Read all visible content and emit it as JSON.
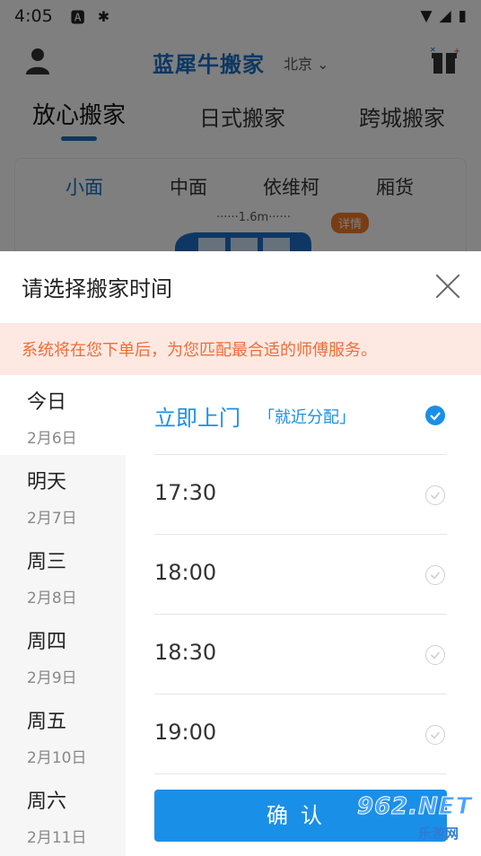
{
  "status_bar": {
    "time": "4:05",
    "icons": [
      "a-icon",
      "bug-icon",
      "wifi-icon",
      "signal-icon",
      "battery-icon"
    ]
  },
  "header": {
    "brand": "蓝犀牛搬家",
    "city": "北京"
  },
  "main_tabs": [
    {
      "label": "放心搬家",
      "active": true
    },
    {
      "label": "日式搬家",
      "active": false
    },
    {
      "label": "跨城搬家",
      "active": false
    }
  ],
  "vehicle_tabs": [
    {
      "label": "小面",
      "active": true
    },
    {
      "label": "中面",
      "active": false
    },
    {
      "label": "依维柯",
      "active": false
    },
    {
      "label": "厢货",
      "active": false
    }
  ],
  "vehicle_card": {
    "dimension": "1.6m",
    "detail_badge": "详情"
  },
  "sheet": {
    "title": "请选择搬家时间",
    "notice": "系统将在您下单后，为您匹配最合适的师傅服务。",
    "dates": [
      {
        "day": "今日",
        "date": "2月6日",
        "selected": true
      },
      {
        "day": "明天",
        "date": "2月7日",
        "selected": false
      },
      {
        "day": "周三",
        "date": "2月8日",
        "selected": false
      },
      {
        "day": "周四",
        "date": "2月9日",
        "selected": false
      },
      {
        "day": "周五",
        "date": "2月10日",
        "selected": false
      },
      {
        "day": "周六",
        "date": "2月11日",
        "selected": false
      }
    ],
    "times": [
      {
        "label": "立即上门",
        "sub": "「就近分配」",
        "selected": true
      },
      {
        "label": "17:30",
        "sub": "",
        "selected": false
      },
      {
        "label": "18:00",
        "sub": "",
        "selected": false
      },
      {
        "label": "18:30",
        "sub": "",
        "selected": false
      },
      {
        "label": "19:00",
        "sub": "",
        "selected": false
      }
    ],
    "confirm_label": "确认"
  },
  "watermark": {
    "top": "962.NET",
    "bottom": "乐游网"
  },
  "colors": {
    "accent": "#1a8fe8",
    "brand": "#1a6fc4",
    "notice_text": "#f26b38",
    "notice_bg": "#fde9e1"
  }
}
